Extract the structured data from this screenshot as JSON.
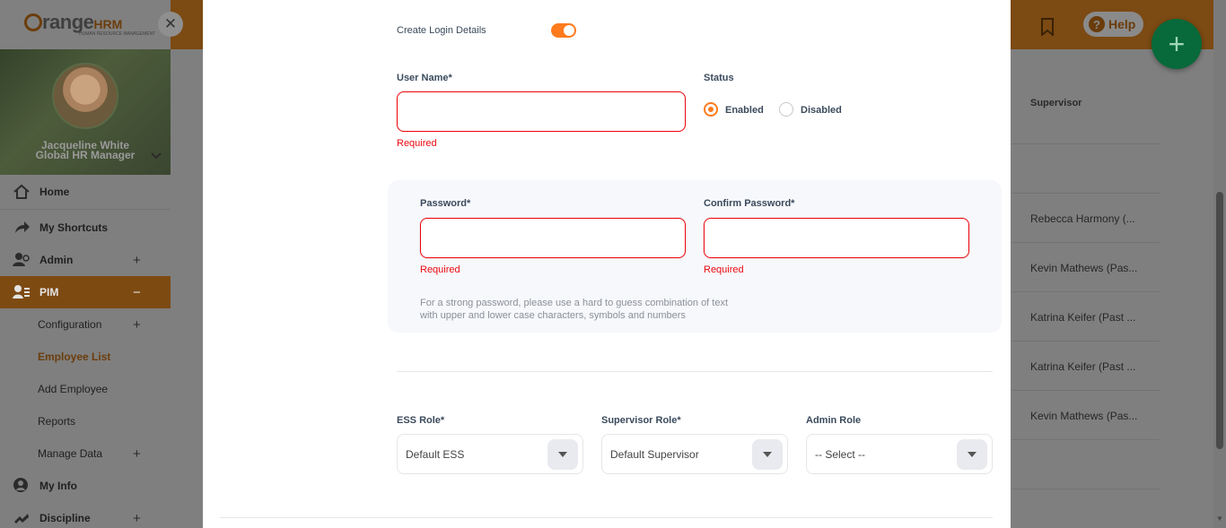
{
  "app": {
    "logo_text": "range",
    "logo_hrm": "HRM",
    "logo_tagline": "HUMAN RESOURCE MANAGEMENT",
    "help_label": "Help"
  },
  "user": {
    "name": "Jacqueline White",
    "role": "Global HR Manager"
  },
  "sidebar": {
    "items": [
      {
        "label": "Home",
        "icon": "home-icon",
        "expandable": false
      },
      {
        "label": "My Shortcuts",
        "icon": "share-arrow-icon",
        "expandable": false
      },
      {
        "label": "Admin",
        "icon": "admin-users-icon",
        "expandable": true
      },
      {
        "label": "PIM",
        "icon": "pim-icon",
        "expandable": true,
        "active": true,
        "expanded": true
      }
    ],
    "pim_sub": [
      {
        "label": "Configuration",
        "expandable": true
      },
      {
        "label": "Employee List",
        "current": true
      },
      {
        "label": "Add Employee"
      },
      {
        "label": "Reports"
      },
      {
        "label": "Manage Data",
        "expandable": true
      }
    ],
    "lower_items": [
      {
        "label": "My Info",
        "icon": "user-circle-icon",
        "expandable": false
      },
      {
        "label": "Discipline",
        "icon": "discipline-icon",
        "expandable": true
      }
    ]
  },
  "background_table": {
    "column_header": "Supervisor",
    "rows": [
      "",
      "Rebecca Harmony (...",
      "Kevin Mathews (Pas...",
      "Katrina Keifer (Past ...",
      "Katrina Keifer (Past ...",
      "Kevin Mathews (Pas...",
      ""
    ]
  },
  "form": {
    "create_login_label": "Create Login Details",
    "create_login_enabled": true,
    "username_label": "User Name*",
    "username_value": "",
    "username_error": "Required",
    "status_label": "Status",
    "status_options": [
      "Enabled",
      "Disabled"
    ],
    "status_selected": "Enabled",
    "password_label": "Password*",
    "password_error": "Required",
    "confirm_password_label": "Confirm Password*",
    "confirm_password_error": "Required",
    "password_hint_line1": "For a strong password, please use a hard to guess combination of text",
    "password_hint_line2": "with upper and lower case characters, symbols and numbers",
    "ess_role_label": "ESS Role*",
    "ess_role_value": "Default ESS",
    "supervisor_role_label": "Supervisor Role*",
    "supervisor_role_value": "Default Supervisor",
    "admin_role_label": "Admin Role",
    "admin_role_value": "-- Select --"
  },
  "colors": {
    "accent": "#ff7b1d",
    "error": "#eb0910",
    "fab": "#0a8a4c"
  }
}
